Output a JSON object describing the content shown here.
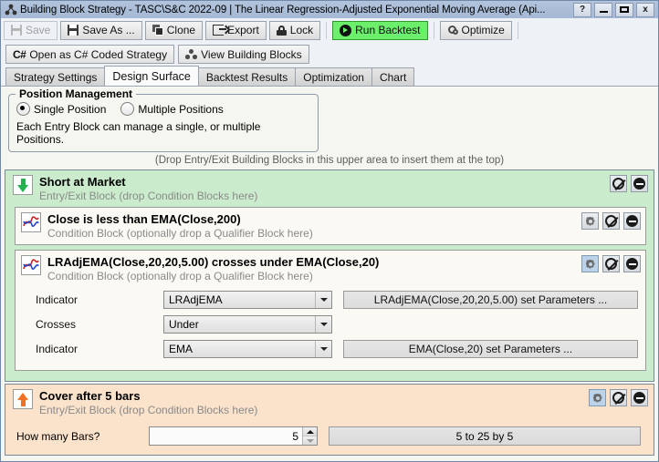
{
  "window": {
    "title": "Building Block Strategy - TASC\\S&C 2022-09 | The Linear Regression-Adjusted Exponential Moving Average (Api...",
    "app_icon": "building-blocks-icon",
    "controls": {
      "help": "?",
      "minimize": "—",
      "maximize": "▭",
      "close": "x"
    }
  },
  "toolbar": {
    "items": [
      {
        "label": "Save",
        "icon": "save-icon",
        "disabled": true
      },
      {
        "label": "Save As ...",
        "icon": "save-as-icon",
        "disabled": false
      },
      {
        "label": "Clone",
        "icon": "clone-icon",
        "disabled": false
      },
      {
        "label": "Export",
        "icon": "export-icon",
        "disabled": false
      },
      {
        "label": "Lock",
        "icon": "lock-icon",
        "disabled": false
      },
      {
        "label": "Run Backtest",
        "icon": "play-icon",
        "highlight": true
      },
      {
        "label": "Optimize",
        "icon": "gear-icon",
        "disabled": false
      }
    ],
    "run_highlight_color": "#6cf06c"
  },
  "toolbar2": {
    "open_csharp": "Open as C# Coded Strategy",
    "open_csharp_icon": "csharp-icon",
    "view_blocks": "View Building Blocks",
    "view_blocks_icon": "building-blocks-icon"
  },
  "tabs": [
    {
      "label": "Strategy Settings",
      "active": false
    },
    {
      "label": "Design Surface",
      "active": true
    },
    {
      "label": "Backtest Results",
      "active": false
    },
    {
      "label": "Optimization",
      "active": false
    },
    {
      "label": "Chart",
      "active": false
    }
  ],
  "position_management": {
    "title": "Position Management",
    "options": [
      {
        "label": "Single Position",
        "checked": true
      },
      {
        "label": "Multiple Positions",
        "checked": false
      }
    ],
    "note": "Each Entry Block can manage a single, or multiple Positions."
  },
  "drop_hint": "(Drop Entry/Exit Building Blocks in this upper area to insert them at the top)",
  "blocks": [
    {
      "id": "short-at-market",
      "title": "Short at Market",
      "subtitle": "Entry/Exit Block (drop Condition Blocks here)",
      "icon": "arrow-down-green-icon",
      "bg_color": "#caeccd",
      "buttons": [
        {
          "name": "disable-icon",
          "glyph": "no-entry"
        },
        {
          "name": "remove-icon",
          "glyph": "minus-circle"
        }
      ],
      "conditions": [
        {
          "title": "Close is less than EMA(Close,200)",
          "subtitle": "Condition Block (optionally drop a Qualifier Block here)",
          "icon": "condition-curve-icon",
          "gear_highlight": false,
          "buttons": [
            {
              "name": "condition-settings-icon",
              "glyph": "gear"
            },
            {
              "name": "disable-icon",
              "glyph": "no-entry"
            },
            {
              "name": "remove-icon",
              "glyph": "minus-circle"
            }
          ],
          "params": []
        },
        {
          "title": "LRAdjEMA(Close,20,20,5.00) crosses under EMA(Close,20)",
          "subtitle": "Condition Block (optionally drop a Qualifier Block here)",
          "icon": "condition-curve-icon",
          "gear_highlight": true,
          "buttons": [
            {
              "name": "condition-settings-icon",
              "glyph": "gear"
            },
            {
              "name": "disable-icon",
              "glyph": "no-entry"
            },
            {
              "name": "remove-icon",
              "glyph": "minus-circle"
            }
          ],
          "params": [
            {
              "label": "Indicator",
              "value": "LRAdjEMA",
              "button": "LRAdjEMA(Close,20,20,5.00) set Parameters ...",
              "has_button": true
            },
            {
              "label": "Crosses",
              "value": "Under",
              "button": "",
              "has_button": false
            },
            {
              "label": "Indicator",
              "value": "EMA",
              "button": "EMA(Close,20) set Parameters ...",
              "has_button": true
            }
          ]
        }
      ]
    },
    {
      "id": "cover-after-5-bars",
      "title": "Cover after 5 bars",
      "subtitle": "Entry/Exit Block (drop Condition Blocks here)",
      "icon": "arrow-up-orange-icon",
      "bg_color": "#fae2cb",
      "gear_highlight": true,
      "buttons": [
        {
          "name": "block-settings-icon",
          "glyph": "gear"
        },
        {
          "name": "disable-icon",
          "glyph": "no-entry"
        },
        {
          "name": "remove-icon",
          "glyph": "minus-circle"
        }
      ],
      "field": {
        "label": "How many Bars?",
        "value": "5",
        "button": "5 to 25 by 5"
      }
    }
  ]
}
